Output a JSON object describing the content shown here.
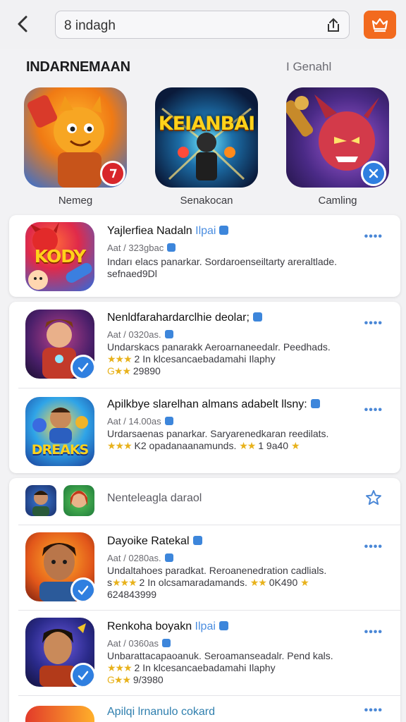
{
  "search": {
    "value": "8 indagh"
  },
  "section": {
    "title": "INDARNEMAAN",
    "link": "I Genahl"
  },
  "featured": [
    {
      "name": "Nemeg"
    },
    {
      "name": "Senakocan",
      "art_text": "KEIANBAI"
    },
    {
      "name": "Camling"
    }
  ],
  "apps": [
    {
      "title": "Yajlerfiea Nadaln",
      "tag": "Ilpai",
      "meta": "Aat / 323gbac",
      "line1": "Indarı elacs panarkar. Sordaroenseiltarty areraltlade.",
      "line2": "sefnaed9Dl",
      "icon_text": "KODY"
    },
    {
      "title": "Nenldfarahardarclhie deolar;",
      "meta": "Aat / 0320as.",
      "line1": "Undarskacs panarakk Aeroarnaneedalr. Peedhads.",
      "line2_stars": "★★★",
      "line2": "2 In klcesancaebadamahi Ilaphy",
      "line3_stars": "G★★",
      "line3": "29890"
    },
    {
      "title": "Apilkbye slarelhan almans adabelt llsny:",
      "meta": "Aat / 14.00as",
      "line1": "Urdarsaenas panarkar. Saryarenedkaran reedilats.",
      "line2_stars": "★★★",
      "line2": "K2 opadanaanamunds.",
      "line2_stars_b": "★★",
      "line2_b": "1 9a40",
      "line2_star_c": "★",
      "icon_text": "DREAKS"
    },
    {
      "title": "Dayoike Ratekal",
      "meta": "Aat / 0280as.",
      "line1": "Undaltahoes paradkat. Reroanenedration cadlials.",
      "line2_prefix": "s",
      "line2_stars": "★★★",
      "line2": "2 In olcsamaradamands.",
      "line2_stars_b": "★★",
      "line2_b": "0K490",
      "line2_star_c": "★",
      "line3": "624843999"
    },
    {
      "title": "Renkoha boyakn",
      "tag": "Ilpai",
      "meta": "Aat / 0360as",
      "line1": "Unbarattacapaoanuk. Seroamanseadalr. Pend kals.",
      "line2_stars": "★★★",
      "line2": "2 In klcesancaebadamahi Ilaphy",
      "line3_stars": "G★★",
      "line3": "9/3980"
    },
    {
      "title": "Apilqi lrnanulo cokard"
    }
  ],
  "group_label": "Nenteleagla daraol",
  "more_label": "••••",
  "colors": {
    "accent": "#f26a1e",
    "link": "#4a87d6",
    "star": "#e8b21c"
  }
}
